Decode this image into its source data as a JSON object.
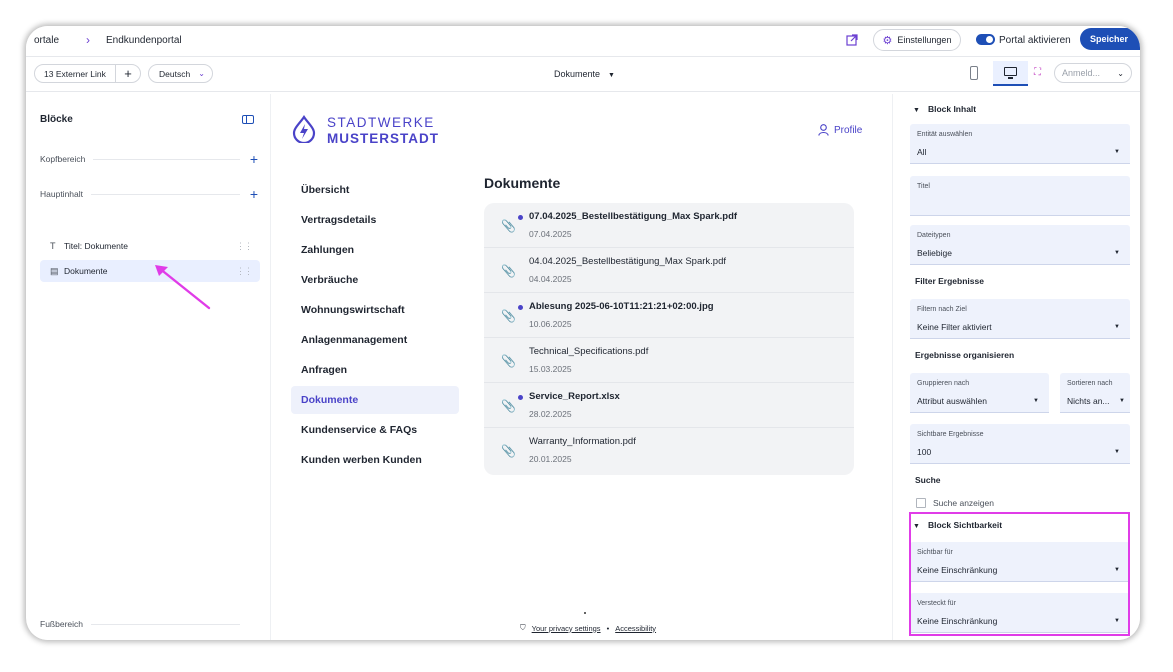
{
  "topbar": {
    "crumb_root": "ortale",
    "crumb_sep": "›",
    "crumb_current": "Endkundenportal",
    "settings_label": "Einstellungen",
    "portal_toggle_label": "Portal aktivieren",
    "save_label": "Speicher"
  },
  "toolbar": {
    "ext_link_label": "13 Externer Link",
    "add_label": "+",
    "language": "Deutsch",
    "doc_select": "Dokumente",
    "login_placeholder": "Anmeld..."
  },
  "blocks": {
    "title": "Blöcke",
    "header_section": "Kopfbereich",
    "main_section": "Hauptinhalt",
    "footer_section": "Fußbereich",
    "items": [
      {
        "icon": "T",
        "label": "Titel: Dokumente"
      },
      {
        "icon": "▤",
        "label": "Dokumente"
      }
    ]
  },
  "preview": {
    "logo_line1": "STADTWERKE",
    "logo_line2": "MUSTERSTADT",
    "profile_label": "Profile",
    "nav": [
      "Übersicht",
      "Vertragsdetails",
      "Zahlungen",
      "Verbräuche",
      "Wohnungswirtschaft",
      "Anlagenmanagement",
      "Anfragen",
      "Dokumente",
      "Kundenservice & FAQs",
      "Kunden werben Kunden"
    ],
    "active_nav": "Dokumente",
    "docs_title": "Dokumente",
    "documents": [
      {
        "name": "07.04.2025_Bestellbestätigung_Max Spark.pdf",
        "date": "07.04.2025",
        "unread": true
      },
      {
        "name": "04.04.2025_Bestellbestätigung_Max Spark.pdf",
        "date": "04.04.2025",
        "unread": false
      },
      {
        "name": "Ablesung 2025-06-10T11:21:21+02:00.jpg",
        "date": "10.06.2025",
        "unread": true
      },
      {
        "name": "Technical_Specifications.pdf",
        "date": "15.03.2025",
        "unread": false
      },
      {
        "name": "Service_Report.xlsx",
        "date": "28.02.2025",
        "unread": true
      },
      {
        "name": "Warranty_Information.pdf",
        "date": "20.01.2025",
        "unread": false
      }
    ],
    "footer": {
      "privacy": "Your privacy settings",
      "separator": "•",
      "accessibility": "Accessibility"
    }
  },
  "config": {
    "block_content_head": "Block Inhalt",
    "entity_label": "Entität auswählen",
    "entity_value": "All",
    "title_label": "Titel",
    "title_value": "",
    "filetypes_label": "Dateitypen",
    "filetypes_value": "Beliebige",
    "filter_section": "Filter Ergebnisse",
    "filter_label": "Filtern nach Ziel",
    "filter_value": "Keine Filter aktiviert",
    "organize_section": "Ergebnisse organisieren",
    "group_label": "Gruppieren nach",
    "group_value": "Attribut auswählen",
    "sort_label": "Sortieren nach",
    "sort_value": "Nichts an...",
    "visible_results_label": "Sichtbare Ergebnisse",
    "visible_results_value": "100",
    "search_section": "Suche",
    "search_checkbox": "Suche anzeigen",
    "visibility_head": "Block Sichtbarkeit",
    "visible_for_label": "Sichtbar für",
    "visible_for_value": "Keine Einschränkung",
    "hidden_for_label": "Versteckt für",
    "hidden_for_value": "Keine Einschränkung"
  },
  "colors": {
    "accent": "#1e4fb6",
    "brand": "#4a43c8",
    "highlight": "#e03ce8"
  }
}
